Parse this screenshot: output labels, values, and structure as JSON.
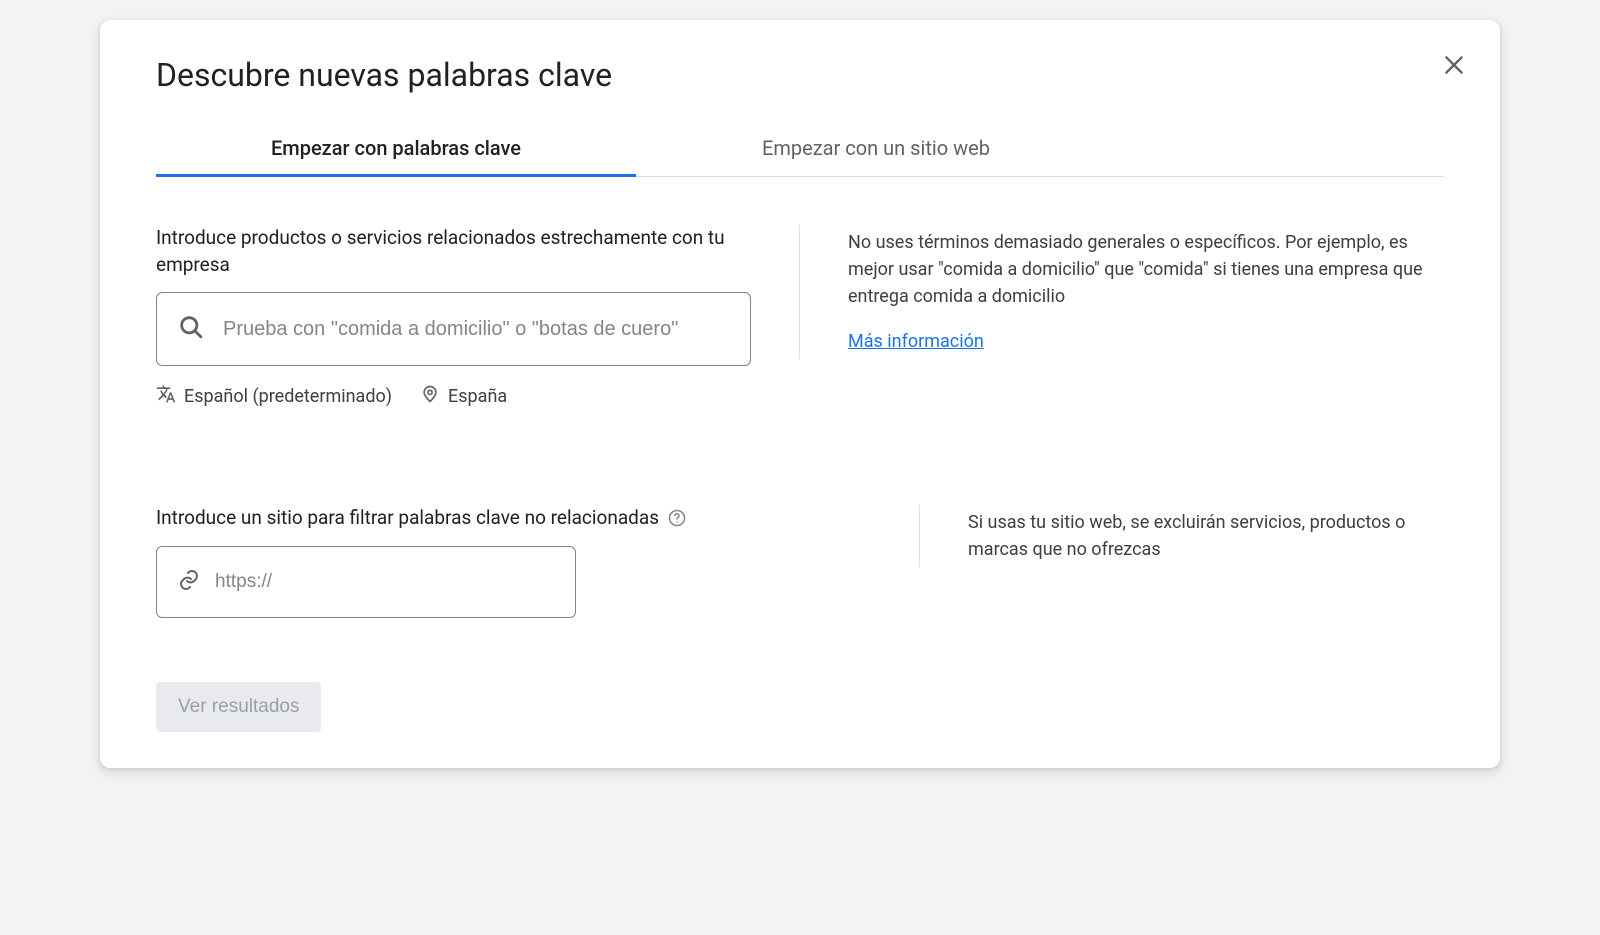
{
  "header": {
    "title": "Descubre nuevas palabras clave"
  },
  "tabs": [
    {
      "label": "Empezar con palabras clave",
      "active": true
    },
    {
      "label": "Empezar con un sitio web",
      "active": false
    }
  ],
  "keywords": {
    "label": "Introduce productos o servicios relacionados estrechamente con tu empresa",
    "placeholder": "Prueba con \"comida a domicilio\" o \"botas de cuero\"",
    "language_label": "Español (predeterminado)",
    "location_label": "España",
    "tip": "No uses términos demasiado generales o específicos. Por ejemplo, es mejor usar \"comida a domicilio\" que \"comida\" si tienes una empresa que entrega comida a domicilio",
    "more_link": "Más información"
  },
  "site": {
    "label": "Introduce un sitio para filtrar palabras clave no relacionadas",
    "placeholder": "https://",
    "tip": "Si usas tu sitio web, se excluirán servicios, productos o marcas que no ofrezcas"
  },
  "submit": {
    "label": "Ver resultados"
  }
}
